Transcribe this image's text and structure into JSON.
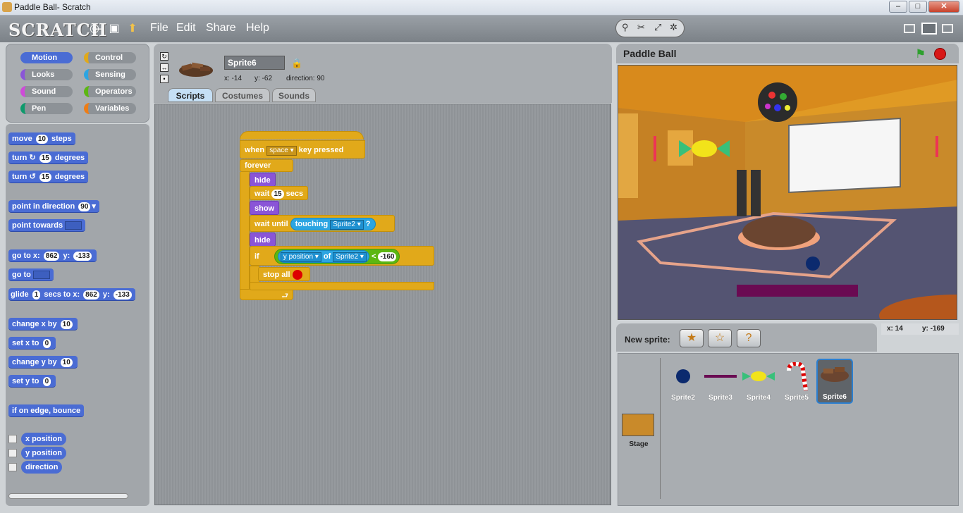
{
  "window": {
    "title": "Paddle Ball- Scratch",
    "min": "–",
    "max": "□",
    "close": "✕"
  },
  "menubar": {
    "logo": "SCRATCH",
    "items": [
      "File",
      "Edit",
      "Share",
      "Help"
    ]
  },
  "categories": [
    "Motion",
    "Looks",
    "Sound",
    "Pen",
    "Control",
    "Sensing",
    "Operators",
    "Variables"
  ],
  "palette": {
    "move": [
      "move",
      "10",
      "steps"
    ],
    "turn_right": [
      "turn",
      "15",
      "degrees"
    ],
    "turn_left": [
      "turn",
      "15",
      "degrees"
    ],
    "point_dir": [
      "point in direction",
      "90"
    ],
    "point_towards": "point towards",
    "goto_xy": [
      "go to x:",
      "862",
      "y:",
      "-133"
    ],
    "goto": "go to",
    "glide": [
      "glide",
      "1",
      "secs to x:",
      "862",
      "y:",
      "-133"
    ],
    "change_x": [
      "change x by",
      "10"
    ],
    "set_x": [
      "set x to",
      "0"
    ],
    "change_y": [
      "change y by",
      "10"
    ],
    "set_y": [
      "set y to",
      "0"
    ],
    "bounce": "if on edge, bounce",
    "reporters": [
      "x position",
      "y position",
      "direction"
    ]
  },
  "sprite": {
    "name": "Sprite6",
    "x_label": "x: -14",
    "y_label": "y: -62",
    "dir_label": "direction: 90"
  },
  "tabs": [
    "Scripts",
    "Costumes",
    "Sounds"
  ],
  "script": {
    "when": "when",
    "key": "space",
    "pressed": "key pressed",
    "forever": "forever",
    "hide": "hide",
    "wait": "wait",
    "secs_val": "15",
    "secs": "secs",
    "show": "show",
    "wait_until": "wait until",
    "touching": "touching",
    "target": "Sprite2",
    "q": "?",
    "hide2": "hide",
    "if": "if",
    "ypos": "y position",
    "of": "of",
    "target2": "Sprite2",
    "lt": "<",
    "limit": "-160",
    "stop_all": "stop all"
  },
  "stage": {
    "title": "Paddle Ball",
    "mouse_x": "x: 14",
    "mouse_y": "y: -169"
  },
  "new_sprite": "New sprite:",
  "sprites": [
    "Sprite2",
    "Sprite3",
    "Sprite4",
    "Sprite5",
    "Sprite6"
  ],
  "stage_thumb": "Stage",
  "colors": {
    "motion": "#4a6cd4",
    "control": "#e1a91a",
    "looks": "#8a55d7",
    "sensing": "#2ca5e2",
    "operators": "#5cb712",
    "sound": "#cf4ad9",
    "pen": "#0e9a6c",
    "variables": "#ee7d16"
  }
}
